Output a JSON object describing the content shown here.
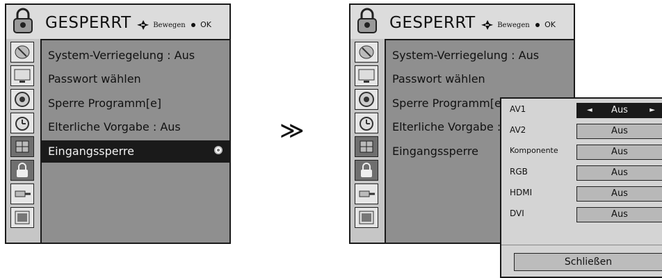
{
  "menu": {
    "title": "GESPERRT",
    "hint_move": "Bewegen",
    "hint_ok": "OK",
    "items": [
      {
        "label": "System-Verriegelung : Aus"
      },
      {
        "label": "Passwort wählen"
      },
      {
        "label": "Sperre Programm[e]"
      },
      {
        "label": "Elterliche Vorgabe : Aus"
      },
      {
        "label": "Eingangssperre"
      }
    ],
    "sidebar_icons": [
      "satellite-dish-icon",
      "tv-screen-icon",
      "speaker-icon",
      "clock-icon",
      "input-lock-icon",
      "lock-icon",
      "plug-icon",
      "photo-icon"
    ]
  },
  "right_menu": {
    "items": [
      {
        "label": "System-Verriegelung : Aus"
      },
      {
        "label": "Passwort wählen"
      },
      {
        "label": "Sperre Programm[e]"
      },
      {
        "label": "Elterliche Vorgabe :"
      },
      {
        "label": "Eingangssperre"
      }
    ]
  },
  "transition_glyph": "≫",
  "submenu": {
    "rows": [
      {
        "label": "AV1",
        "value": "Aus",
        "active": true
      },
      {
        "label": "AV2",
        "value": "Aus"
      },
      {
        "label": "Komponente",
        "value": "Aus"
      },
      {
        "label": "RGB",
        "value": "Aus"
      },
      {
        "label": "HDMI",
        "value": "Aus"
      },
      {
        "label": "DVI",
        "value": "Aus"
      }
    ],
    "close_label": "Schließen",
    "left_arrow": "◄",
    "right_arrow": "►"
  }
}
